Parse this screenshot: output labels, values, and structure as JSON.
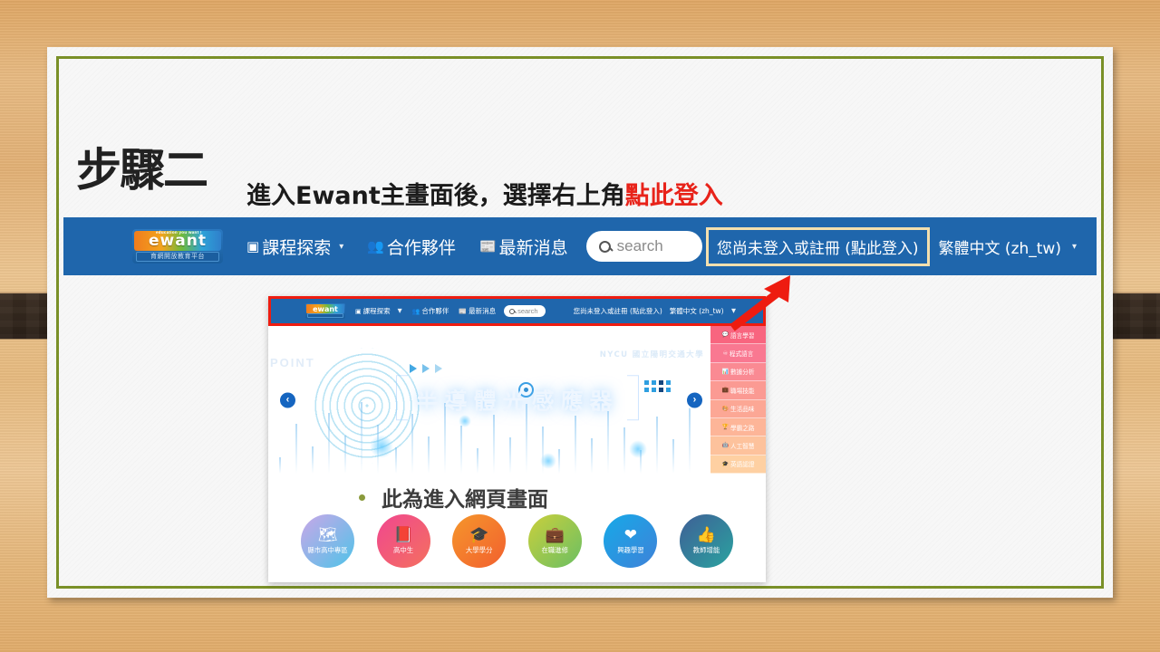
{
  "slide": {
    "step_title": "步驟二",
    "subtitle_plain": "進入Ewant主畫面後，選擇右上角",
    "subtitle_highlight": "點此登入",
    "caption": "此為進入網頁畫面",
    "accent_green": "#7a9028",
    "highlight_red": "#e8231a",
    "nav_blue": "#1f66ac",
    "highlight_box_color": "#f3dfae"
  },
  "navbar": {
    "logo": {
      "wordmark": "ewant",
      "tagline": "education you want !",
      "subtitle": "育網開放教育平台"
    },
    "items": [
      {
        "icon": "monitor-icon",
        "glyph": "▣",
        "label": "課程探索",
        "has_caret": true
      },
      {
        "icon": "people-icon",
        "glyph": "👥",
        "label": "合作夥伴",
        "has_caret": false
      },
      {
        "icon": "news-icon",
        "glyph": "📰",
        "label": "最新消息",
        "has_caret": false
      }
    ],
    "search": {
      "icon": "search-icon",
      "placeholder": "search"
    },
    "login_label": "您尚未登入或註冊 (點此登入)",
    "language_label": "繁體中文 (zh_tw)",
    "caret_glyph": "▾"
  },
  "screenshot": {
    "navbar": {
      "logo_wordmark": "ewant",
      "items": [
        {
          "glyph": "▣",
          "label": "課程探索",
          "has_caret": true
        },
        {
          "glyph": "👥",
          "label": "合作夥伴",
          "has_caret": false
        },
        {
          "glyph": "📰",
          "label": "最新消息",
          "has_caret": false
        }
      ],
      "search_placeholder": "search",
      "login_label": "您尚未登入或註冊 (點此登入)",
      "language_label": "繁體中文 (zh_tw)"
    },
    "banner": {
      "title": "半導體光感應器",
      "university": "NYCU 國立陽明交通大學",
      "ghost_text": "POINT",
      "prev_glyph": "‹",
      "next_glyph": "›"
    },
    "categories": [
      {
        "glyph": "💬",
        "label": "語言學習",
        "color": "#f8657f"
      },
      {
        "glyph": "♾",
        "label": "程式語言",
        "color": "#f97891"
      },
      {
        "glyph": "📊",
        "label": "數據分析",
        "color": "#fa8a93"
      },
      {
        "glyph": "💼",
        "label": "職場技能",
        "color": "#fb9a93"
      },
      {
        "glyph": "🎨",
        "label": "生活品味",
        "color": "#fca795"
      },
      {
        "glyph": "🏆",
        "label": "學霸之路",
        "color": "#fdb598"
      },
      {
        "glyph": "🤖",
        "label": "人工智慧",
        "color": "#fdc29c"
      },
      {
        "glyph": "🎓",
        "label": "英語認證",
        "color": "#fed0a2"
      }
    ],
    "circles": [
      {
        "label": "縣市高中專區",
        "glyph": "🗺",
        "c1": "#c9a7e8",
        "c2": "#4fc3e8"
      },
      {
        "label": "高中生",
        "glyph": "📕",
        "c1": "#f0478f",
        "c2": "#f4705f"
      },
      {
        "label": "大學學分",
        "glyph": "🎓",
        "c1": "#f5962c",
        "c2": "#f2602e"
      },
      {
        "label": "在職進修",
        "glyph": "💼",
        "c1": "#c9cf3c",
        "c2": "#6bbf63"
      },
      {
        "label": "興趣學習",
        "glyph": "❤",
        "c1": "#16a9e8",
        "c2": "#3f82d8"
      },
      {
        "label": "教師增能",
        "glyph": "👍",
        "c1": "#3f5f96",
        "c2": "#2aa3a0"
      }
    ]
  }
}
